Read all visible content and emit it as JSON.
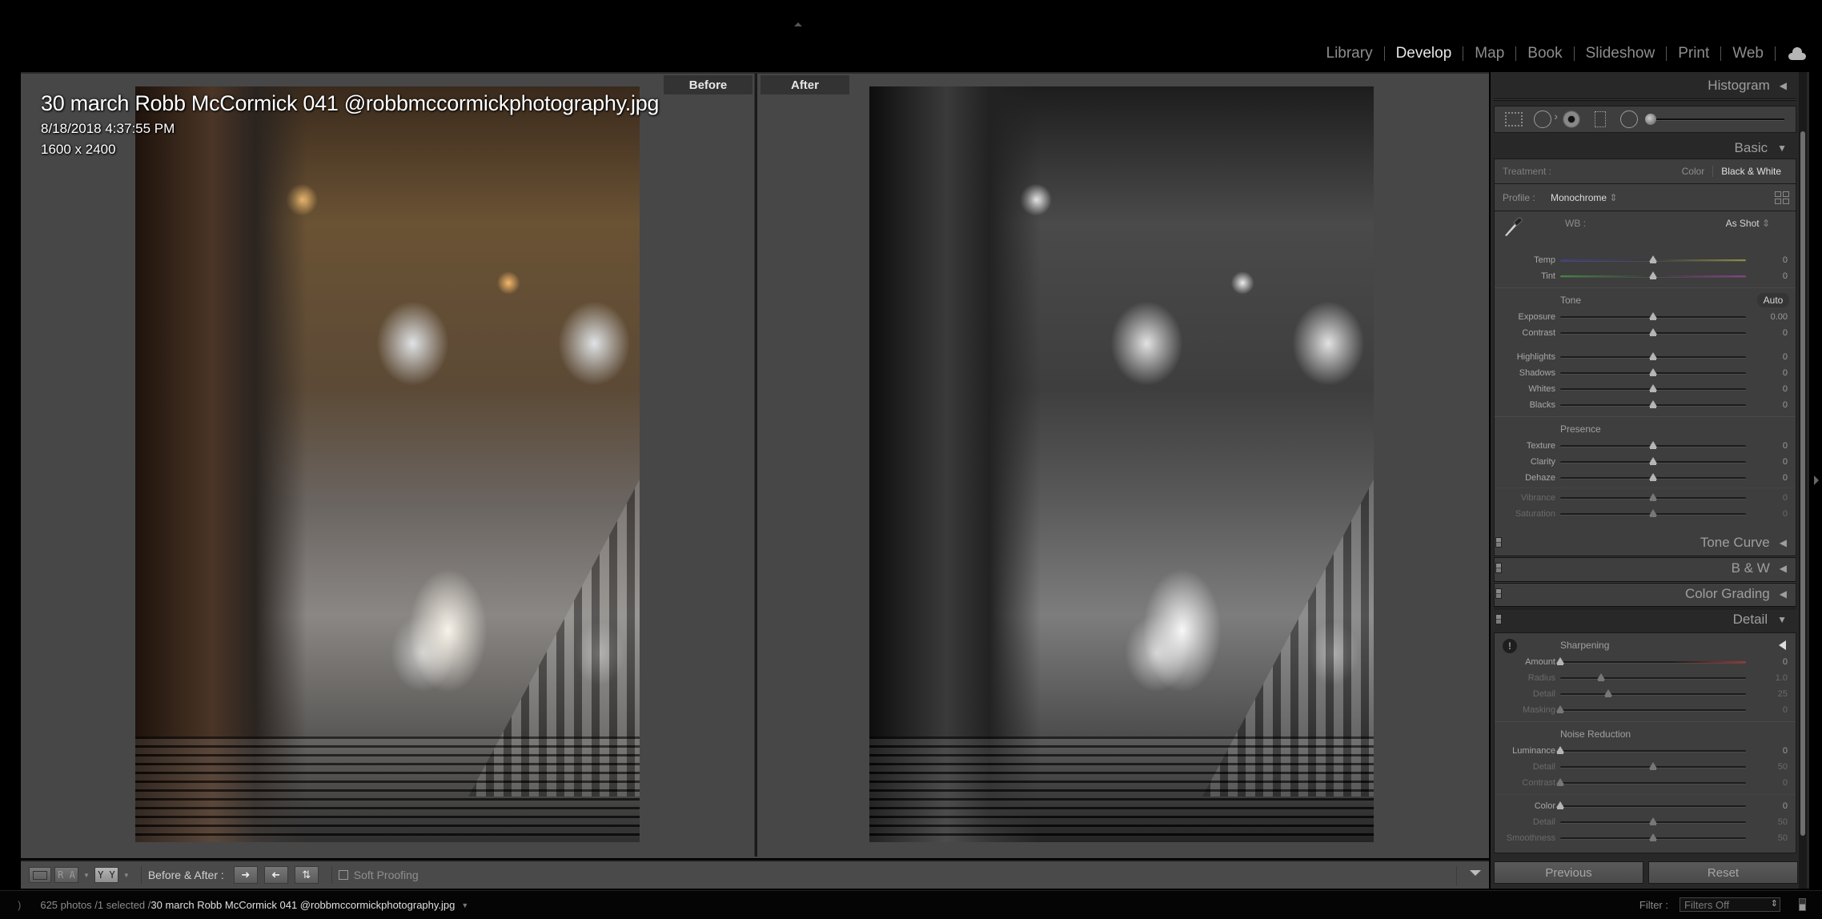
{
  "modules": {
    "items": [
      "Library",
      "Develop",
      "Map",
      "Book",
      "Slideshow",
      "Print",
      "Web"
    ],
    "active": "Develop",
    "cloud_icon": "cloud-icon"
  },
  "view": {
    "before_label": "Before",
    "after_label": "After",
    "info": {
      "filename": "30 march Robb McCormick 041 @robbmccormickphotography.jpg",
      "datetime": "8/18/2018 4:37:55 PM",
      "dimensions": "1600 x 2400"
    }
  },
  "toolbar": {
    "view_ra": "R A",
    "view_yy": "Y Y",
    "before_after_label": "Before & After :",
    "soft_proofing_label": "Soft Proofing",
    "soft_proofing_checked": false
  },
  "panel": {
    "histogram_title": "Histogram",
    "basic_title": "Basic",
    "treatment": {
      "label": "Treatment :",
      "options": [
        "Color",
        "Black & White"
      ],
      "selected": "Black & White"
    },
    "profile": {
      "label": "Profile :",
      "value": "Monochrome"
    },
    "wb": {
      "label": "WB :",
      "value": "As Shot"
    },
    "wb_sliders": [
      {
        "label": "Temp",
        "value": "0",
        "position": 0.5
      },
      {
        "label": "Tint",
        "value": "0",
        "position": 0.5
      }
    ],
    "tone": {
      "heading": "Tone",
      "auto_label": "Auto",
      "sliders": [
        {
          "label": "Exposure",
          "value": "0.00",
          "position": 0.5
        },
        {
          "label": "Contrast",
          "value": "0",
          "position": 0.5
        },
        {
          "label": "Highlights",
          "value": "0",
          "position": 0.5
        },
        {
          "label": "Shadows",
          "value": "0",
          "position": 0.5
        },
        {
          "label": "Whites",
          "value": "0",
          "position": 0.5
        },
        {
          "label": "Blacks",
          "value": "0",
          "position": 0.5
        }
      ]
    },
    "presence": {
      "heading": "Presence",
      "sliders": [
        {
          "label": "Texture",
          "value": "0",
          "position": 0.5
        },
        {
          "label": "Clarity",
          "value": "0",
          "position": 0.5
        },
        {
          "label": "Dehaze",
          "value": "0",
          "position": 0.5
        },
        {
          "label": "Vibrance",
          "value": "0",
          "position": 0.5,
          "disabled": true
        },
        {
          "label": "Saturation",
          "value": "0",
          "position": 0.5,
          "disabled": true
        }
      ]
    },
    "collapsed_sections": [
      "Tone Curve",
      "B & W",
      "Color Grading"
    ],
    "detail_title": "Detail",
    "sharpening": {
      "heading": "Sharpening",
      "sliders": [
        {
          "label": "Amount",
          "value": "0",
          "position": 0.0
        },
        {
          "label": "Radius",
          "value": "1.0",
          "position": 0.22,
          "disabled": true
        },
        {
          "label": "Detail",
          "value": "25",
          "position": 0.26,
          "disabled": true
        },
        {
          "label": "Masking",
          "value": "0",
          "position": 0.0,
          "disabled": true
        }
      ]
    },
    "noise_reduction": {
      "heading": "Noise Reduction",
      "sliders": [
        {
          "label": "Luminance",
          "value": "0",
          "position": 0.0
        },
        {
          "label": "Detail",
          "value": "50",
          "position": 0.5,
          "disabled": true
        },
        {
          "label": "Contrast",
          "value": "0",
          "position": 0.0,
          "disabled": true
        }
      ],
      "color_sliders": [
        {
          "label": "Color",
          "value": "0",
          "position": 0.0
        },
        {
          "label": "Detail",
          "value": "50",
          "position": 0.5,
          "disabled": true
        },
        {
          "label": "Smoothness",
          "value": "50",
          "position": 0.5,
          "disabled": true
        }
      ]
    },
    "previous_label": "Previous",
    "reset_label": "Reset"
  },
  "status": {
    "count": "625 photos /1 selected /",
    "filename": "30 march Robb McCormick 041 @robbmccormickphotography.jpg",
    "filter_label": "Filter :",
    "filter_value": "Filters Off"
  }
}
